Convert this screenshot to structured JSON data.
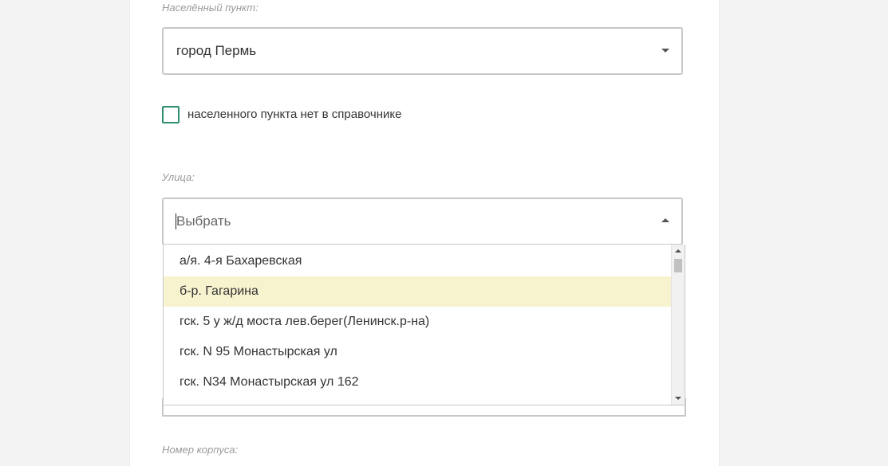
{
  "locality": {
    "label": "Населённый пункт:",
    "value": "город Пермь"
  },
  "locality_missing": {
    "label": "населенного пункта нет в справочнике",
    "checked": false
  },
  "street": {
    "label": "Улица:",
    "placeholder": "Выбрать",
    "options": [
      "а/я. 4-я Бахаревская",
      "б-р. Гагарина",
      "гск. 5 у ж/д моста лев.берег(Ленинск.р-на)",
      "гск. N 95 Монастырская ул",
      "гск. N34 Монастырская ул 162"
    ],
    "highlighted_index": 1
  },
  "building": {
    "label": "Номер корпуса:"
  },
  "colors": {
    "checkbox_border": "#2f8f6f",
    "highlight": "#f8f3cf"
  }
}
